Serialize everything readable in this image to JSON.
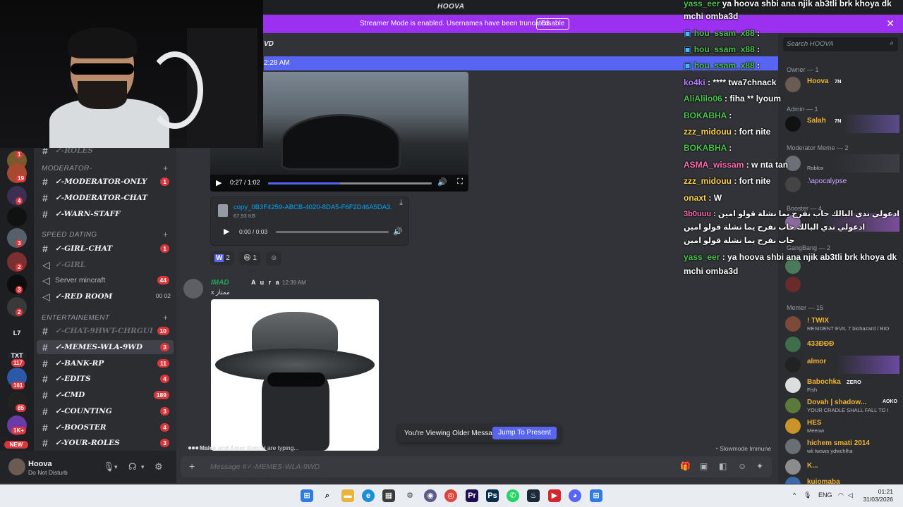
{
  "window": {
    "title": "HOOVA"
  },
  "banner": {
    "message": "Streamer Mode is enabled. Usernames have been truncated.",
    "button": "Disable",
    "close": "✕"
  },
  "server_rail": {
    "badges": [
      "1",
      "19",
      "4",
      "3",
      "2",
      "3",
      "2",
      "3",
      "117",
      "161",
      "85",
      "1K+"
    ],
    "labels": [
      "L7",
      "TXT",
      "NEW"
    ]
  },
  "channels": {
    "categories": [
      {
        "name": "MODERATOR-"
      },
      {
        "name": "SPEED DATING"
      },
      {
        "name": "ENTERTAINEMENT"
      }
    ],
    "items": [
      {
        "name": "✓-ROLES",
        "count": ""
      },
      {
        "name": "✓-MODERATOR-ONLY",
        "count": "1"
      },
      {
        "name": "✓-MODERATOR-CHAT",
        "count": ""
      },
      {
        "name": "✓-WARN-STAFF",
        "count": ""
      },
      {
        "name": "✓-GIRL-CHAT",
        "count": "1"
      },
      {
        "name": "✓-GIRL",
        "count": ""
      },
      {
        "name": "Server mincraft",
        "count": "44"
      },
      {
        "name": "✓-RED ROOM",
        "count": "00 02"
      },
      {
        "name": "✓-CHAT-9HWT-CHRGUI",
        "count": "10"
      },
      {
        "name": "✓-MEMES-WLA-9WD",
        "count": "3"
      },
      {
        "name": "✓-BANK-RP",
        "count": "11"
      },
      {
        "name": "✓-EDITS",
        "count": "4"
      },
      {
        "name": "✓-CMD",
        "count": "189"
      },
      {
        "name": "✓-COUNTING",
        "count": "3"
      },
      {
        "name": "✓-BOOSTER",
        "count": "4"
      },
      {
        "name": "✓-YOUR-ROLES",
        "count": "3"
      }
    ]
  },
  "user_panel": {
    "name": "Hoova",
    "status": "Do Not Disturb"
  },
  "chat": {
    "header_time": "2:28 AM",
    "header_partial": "VD",
    "video": {
      "time": "0:27 / 1:02",
      "progress": 0.44
    },
    "attachment": {
      "filename": "copy_0B3F4259-ABCB-4020-8DA5-F6F2D46A5DA3.",
      "size": "67.93 KB",
      "audio_time": "0:00 / 0:03"
    },
    "reactions": [
      {
        "emoji": "W",
        "count": "2"
      },
      {
        "emoji": "😆",
        "count": "1"
      },
      {
        "emoji": "☺",
        "count": ""
      }
    ],
    "message": {
      "author": "IMAD",
      "tag": "A u r a",
      "time": "12:39 AM",
      "body": "x ممتاز"
    },
    "jump": {
      "text": "You're Viewing Older Messages",
      "button": "Jump To Present"
    },
    "typing": {
      "users": "Malek and Amer Botchi",
      "suffix": "are typing..."
    },
    "slowmode": "Slowmode Immune",
    "composer_placeholder": "Message #✓-MEMES-WLA-9WD"
  },
  "stream_chat": [
    {
      "user": "yass_eer",
      "text": "ya hoova shbi ana njik ab3tli brk khoya dk"
    },
    {
      "user": "",
      "text": "mchi omba3d"
    },
    {
      "user": "hou_ssam_x88",
      "text": ":"
    },
    {
      "user": "hou_ssam_x88",
      "text": ":"
    },
    {
      "user": "hou_ssam_x88",
      "text": ":"
    },
    {
      "user": "ko4ki",
      "text": ": **** twa7chnack"
    },
    {
      "user": "AliAlilo06",
      "text": ": fiha ** lyoum"
    },
    {
      "user": "BOKABHA",
      "text": ":"
    },
    {
      "user": "zzz_midouu",
      "text": ": fort nite"
    },
    {
      "user": "BOKABHA",
      "text": ":"
    },
    {
      "user": "ASMA_wissam",
      "text": ": w nta tan"
    },
    {
      "user": "zzz_midouu",
      "text": ": fort nite"
    },
    {
      "user": "onaxt",
      "text": ": W"
    },
    {
      "user": "3b0uuu",
      "text": ": ادعولي ندي البالك حاب نفرح يما نشلة قولو امين"
    },
    {
      "user": "",
      "text": "ادعولي ندي البالك حاب نفرح يما نشلة قولو امين"
    },
    {
      "user": "",
      "text": "حاب نفرح يما نشلة قولو امين"
    },
    {
      "user": "yass_eer",
      "text": ": ya hoova shbi ana njik ab3tli brk khoya dk"
    },
    {
      "user": "",
      "text": "mchi omba3d"
    }
  ],
  "members": {
    "search_placeholder": "Search HOOVA",
    "groups": [
      {
        "title": "Owner — 1"
      },
      {
        "title": "Admin — 1"
      },
      {
        "title": "Moderator Meme — 2"
      },
      {
        "title": "Booster — 4"
      },
      {
        "title": "GangBang — 2"
      },
      {
        "title": "Memer — 15"
      }
    ],
    "list": [
      {
        "name": "Hoova",
        "sub": "",
        "color": "#f0b232"
      },
      {
        "name": "Salah",
        "sub": "",
        "color": "#f0b232"
      },
      {
        "name": "",
        "sub": "Roblox",
        "color": "#b5bac1"
      },
      {
        "name": ".\\apocalypse",
        "sub": "",
        "color": "#c9a7ff"
      },
      {
        "name": "! TWIX",
        "sub": "RESIDENT EVIL 7 biohazard / BIO",
        "color": "#f0b232"
      },
      {
        "name": "433ƉƉƉ",
        "sub": "",
        "color": "#f0b232"
      },
      {
        "name": "almor",
        "sub": "",
        "color": "#f0b232"
      },
      {
        "name": "Babochka",
        "sub": "Fish",
        "color": "#f0b232"
      },
      {
        "name": "Dovah | shadow...",
        "sub": "YOUR CRADLE SHALL FALL TO I",
        "color": "#f0b232"
      },
      {
        "name": "HES",
        "sub": "Meeow",
        "color": "#f0b232"
      },
      {
        "name": "hichem smati 2014",
        "sub": "wli twsws ydwchlha",
        "color": "#f0b232"
      },
      {
        "name": "K...",
        "sub": "",
        "color": "#f0b232"
      },
      {
        "name": "kuiomaba",
        "sub": "",
        "color": "#f0b232"
      }
    ],
    "tags": {
      "hoova": "7N",
      "salah": "7N",
      "babochka": "ZERO",
      "dovah": "AOKO"
    }
  },
  "taskbar": {
    "lang": "ENG",
    "time": "01:21",
    "date": "31/03/2026"
  }
}
